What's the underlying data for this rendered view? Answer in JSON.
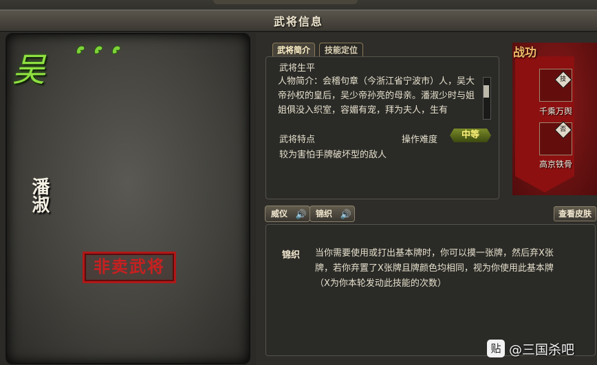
{
  "window": {
    "title": "武将信息"
  },
  "general": {
    "kingdom_glyph": "吴",
    "health_count": 3,
    "name": "潘淑",
    "stamp": "非卖武将"
  },
  "tabs": [
    {
      "label": "武将简介",
      "active": true
    },
    {
      "label": "技能定位",
      "active": false
    }
  ],
  "info": {
    "bio_label": "武将生平",
    "bio_text": "人物简介：会稽句章（今浙江省宁波市）人，吴大帝孙权的皇后，吴少帝孙亮的母亲。潘淑少时与姐姐俱没入织室，容媚有宠，拜为夫人，生有",
    "feature_label": "武将特点",
    "difficulty_label": "操作难度",
    "difficulty_value": "中等",
    "feature_text": "较为害怕手牌破坏型的敌人"
  },
  "war_record": {
    "title": "战功",
    "slots": [
      {
        "badge": "技",
        "name": "千乘万舆"
      },
      {
        "badge": "否",
        "name": "高京铁骨"
      }
    ]
  },
  "voice_buttons": [
    {
      "label": "威仪",
      "icon": "speaker-icon"
    },
    {
      "label": "锦织",
      "icon": "speaker-icon"
    }
  ],
  "skin_button": "查看皮肤",
  "skill_detail": {
    "name": "锦织",
    "text": "当你需要使用或打出基本牌时，你可以摸一张牌，然后弃X张牌，若你弃置了X张牌且牌颜色均相同，视为你使用此基本牌（X为你本轮发动此技能的次数）"
  },
  "watermark": {
    "icon": "贴",
    "text": "@三国杀吧"
  },
  "colors": {
    "kingdom": "#8ee040",
    "stamp": "#c82020",
    "banner": "#8c1010",
    "difficulty_badge": "#5a6a1c"
  }
}
